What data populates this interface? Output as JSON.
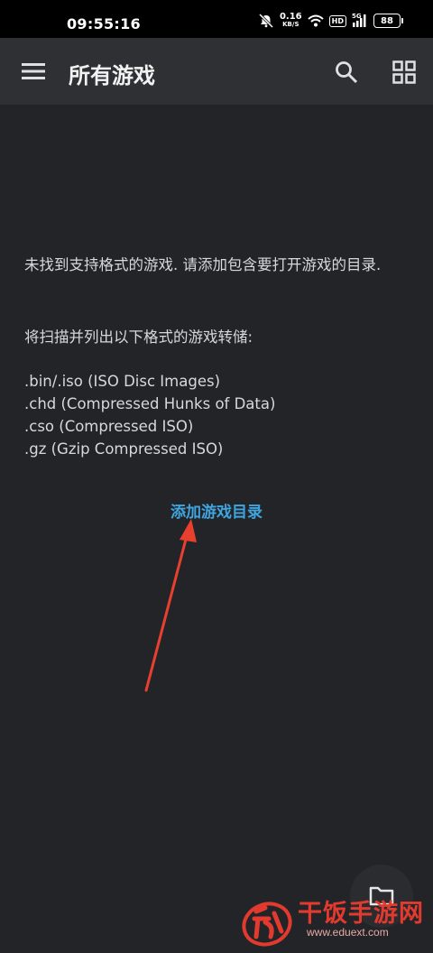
{
  "status_bar": {
    "time": "09:55:16",
    "net_speed_value": "0.16",
    "net_speed_unit": "KB/S",
    "hd_label": "HD",
    "signal_label": "5G",
    "battery": "88",
    "icons": [
      "mute-icon",
      "wifi-icon",
      "signal-icon",
      "battery-icon"
    ]
  },
  "app_bar": {
    "title": "所有游戏",
    "icons": [
      "menu-icon",
      "search-icon",
      "grid-view-icon"
    ]
  },
  "empty_state": {
    "message": "未找到支持格式的游戏. 请添加包含要打开游戏的目录.",
    "scan_info": "将扫描并列出以下格式的游戏转储:",
    "formats": [
      ".bin/.iso (ISO Disc Images)",
      ".chd (Compressed Hunks of Data)",
      ".cso (Compressed ISO)",
      ".gz (Gzip Compressed ISO)"
    ],
    "add_directory": "添加游戏目录"
  },
  "fab": {
    "icon": "folder-icon"
  },
  "watermark": {
    "title": "干饭手游网",
    "url": "www.eduext.com"
  },
  "colors": {
    "background": "#232428",
    "app_bar": "#2f3034",
    "link": "#3fa5de",
    "annotation_arrow": "#e8402f",
    "watermark": "#e23a2e"
  }
}
